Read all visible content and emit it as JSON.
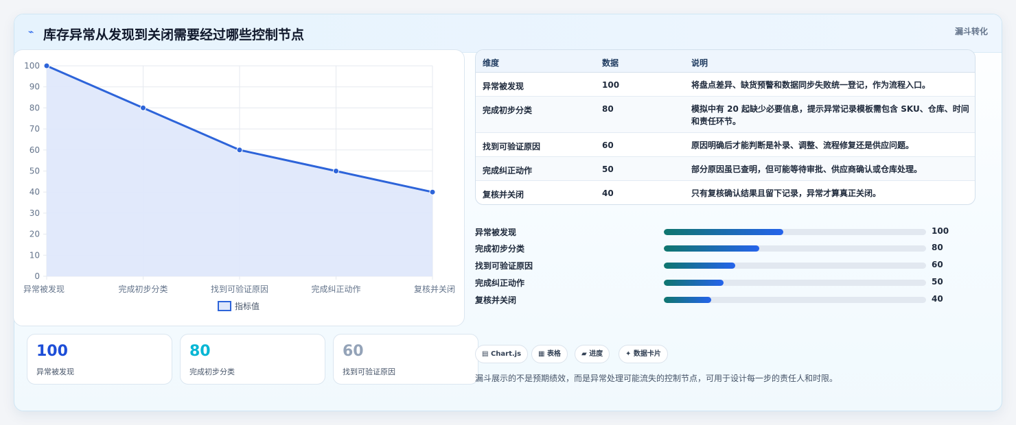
{
  "header": {
    "icon": "lightning-icon",
    "title": "库存异常从发现到关闭需要经过哪些控制节点",
    "tag": "漏斗转化"
  },
  "chart_data": {
    "type": "line",
    "categories": [
      "异常被发现",
      "完成初步分类",
      "找到可验证原因",
      "完成纠正动作",
      "复核并关闭"
    ],
    "series": [
      {
        "name": "指标值",
        "values": [
          100,
          80,
          60,
          50,
          40
        ]
      }
    ],
    "ylim": [
      0,
      100
    ],
    "yticks": [
      0,
      10,
      20,
      30,
      40,
      50,
      60,
      70,
      80,
      90,
      100
    ],
    "grid": true,
    "fill": true,
    "legend": "bottom",
    "colors": {
      "line": "#2d64d9",
      "area": "#dfe8fb"
    }
  },
  "stats": [
    {
      "value": "100",
      "label": "异常被发现",
      "color": "#1d4ed8"
    },
    {
      "value": "80",
      "label": "完成初步分类",
      "color": "#06b6d4"
    },
    {
      "value": "60",
      "label": "找到可验证原因",
      "color": "#94a3b8"
    }
  ],
  "table": {
    "headers": [
      "维度",
      "数据",
      "说明"
    ],
    "rows": [
      {
        "dim": "异常被发现",
        "val": "100",
        "desc": "将盘点差异、缺货预警和数据同步失败统一登记，作为流程入口。"
      },
      {
        "dim": "完成初步分类",
        "val": "80",
        "desc": "模拟中有 20 起缺少必要信息，提示异常记录模板需包含 SKU、仓库、时间和责任环节。"
      },
      {
        "dim": "找到可验证原因",
        "val": "60",
        "desc": "原因明确后才能判断是补录、调整、流程修复还是供应问题。"
      },
      {
        "dim": "完成纠正动作",
        "val": "50",
        "desc": "部分原因虽已查明，但可能等待审批、供应商确认或仓库处理。"
      },
      {
        "dim": "复核并关闭",
        "val": "40",
        "desc": "只有复核确认结果且留下记录，异常才算真正关闭。"
      }
    ]
  },
  "progress": {
    "max": 220,
    "items": [
      {
        "label": "异常被发现",
        "value": 100
      },
      {
        "label": "完成初步分类",
        "value": 80
      },
      {
        "label": "找到可验证原因",
        "value": 60
      },
      {
        "label": "完成纠正动作",
        "value": 50
      },
      {
        "label": "复核并关闭",
        "value": 40
      }
    ]
  },
  "chips": [
    {
      "icon": "▤",
      "label": "Chart.js"
    },
    {
      "icon": "▦",
      "label": "表格"
    },
    {
      "icon": "▰",
      "label": "进度"
    },
    {
      "icon": "✦",
      "label": "数据卡片"
    }
  ],
  "footnote": "漏斗展示的不是预期绩效，而是异常处理可能流失的控制节点，可用于设计每一步的责任人和时限。"
}
